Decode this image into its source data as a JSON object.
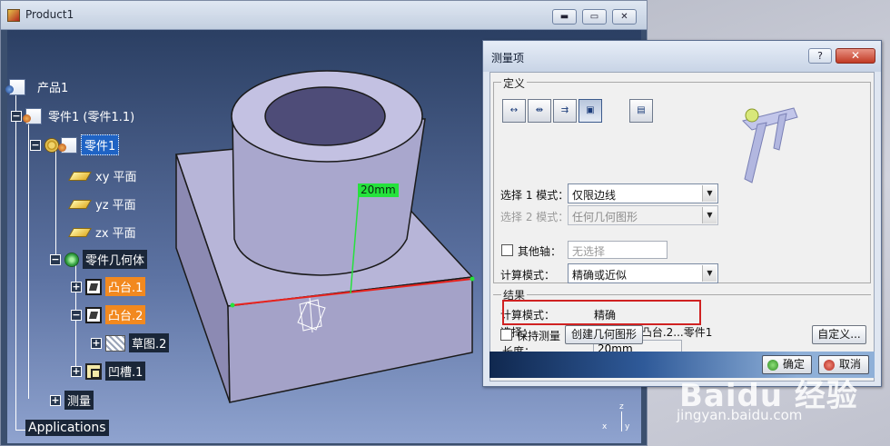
{
  "window": {
    "title": "Product1",
    "minimize_glyph": "▬",
    "maximize_glyph": "▭",
    "close_glyph": "✕"
  },
  "tree": {
    "product": "产品1",
    "part_instance": "零件1 (零件1.1)",
    "part": "零件1",
    "xy_plane": "xy 平面",
    "yz_plane": "yz 平面",
    "zx_plane": "zx 平面",
    "part_body": "零件几何体",
    "pad1": "凸台.1",
    "pad2": "凸台.2",
    "sketch2": "草图.2",
    "pocket1": "凹槽.1",
    "measure": "测量",
    "applications": "Applications"
  },
  "viewport": {
    "dimension_tag": "20mm",
    "axis_z": "z",
    "axis_x": "x",
    "axis_y": "y"
  },
  "dialog": {
    "title": "测量项",
    "help": "?",
    "close": "✕",
    "definition_group": "定义",
    "select1_label": "选择 1 模式：",
    "select1_value": "仅限边线",
    "select2_label": "选择 2 模式：",
    "select2_value": "任何几何图形",
    "other_axis_label": "其他轴：",
    "other_axis_value": "无选择",
    "calc_mode_label": "计算模式：",
    "calc_mode_value": "精确或近似",
    "result_group": "结果",
    "result_calc_label": "计算模式：",
    "result_calc_value": "精确",
    "result_select_label": "选择：",
    "result_select_value": "直线 范围凸台.2...零件1",
    "length_label": "长度：",
    "length_value": "20mm",
    "keep_measure_label": "保持测量",
    "create_geometry_button": "创建几何图形",
    "customize_button": "自定义...",
    "ok_button": "确定",
    "cancel_button": "取消"
  },
  "watermark": {
    "logo": "Baidu 经验",
    "url": "jingyan.baidu.com"
  },
  "colors": {
    "viewport_top": "#2b3f63",
    "selection_highlight": "#f2891f",
    "dimension_green": "#25e23c",
    "measured_edge_red": "#e8231e",
    "result_box_red": "#d02222"
  }
}
